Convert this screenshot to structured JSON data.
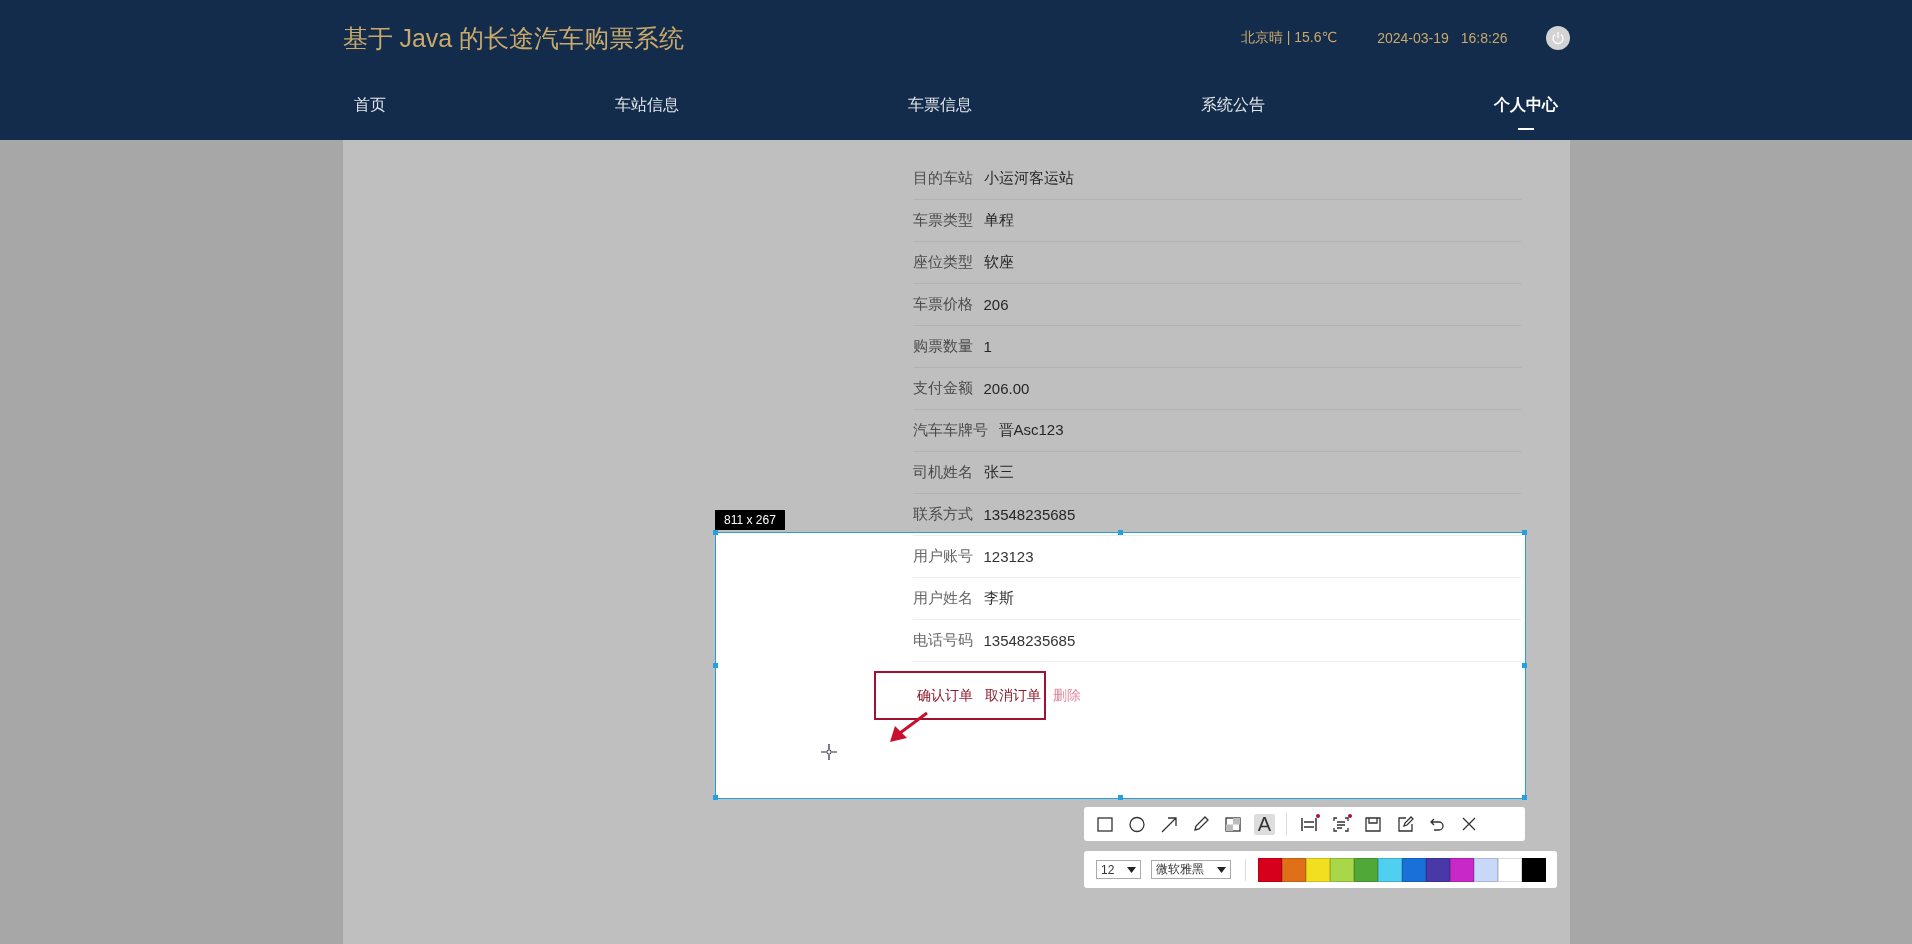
{
  "header": {
    "title": "基于 Java 的长途汽车购票系统",
    "weather": "北京晴 | 15.6℃",
    "date": "2024-03-19",
    "time": "16:8:26"
  },
  "nav": [
    {
      "label": "首页",
      "selected": false
    },
    {
      "label": "车站信息",
      "selected": false
    },
    {
      "label": "车票信息",
      "selected": false
    },
    {
      "label": "系统公告",
      "selected": false
    },
    {
      "label": "个人中心",
      "selected": true
    }
  ],
  "details": [
    {
      "label": "目的车站",
      "value": "小运河客运站"
    },
    {
      "label": "车票类型",
      "value": "单程"
    },
    {
      "label": "座位类型",
      "value": "软座"
    },
    {
      "label": "车票价格",
      "value": "206"
    },
    {
      "label": "购票数量",
      "value": "1"
    },
    {
      "label": "支付金额",
      "value": "206.00"
    },
    {
      "label": "汽车车牌号",
      "value": "晋Asc123"
    },
    {
      "label": "司机姓名",
      "value": "张三"
    },
    {
      "label": "联系方式",
      "value": "13548235685"
    },
    {
      "label": "用户账号",
      "value": "123123"
    },
    {
      "label": "用户姓名",
      "value": "李斯"
    },
    {
      "label": "电话号码",
      "value": "13548235685"
    }
  ],
  "actions": [
    {
      "label": "确认订单",
      "kind": "primary"
    },
    {
      "label": "取消订单",
      "kind": "primary"
    },
    {
      "label": "删除",
      "kind": "danger"
    }
  ],
  "snip": {
    "size_label": "811 x 267",
    "tools": [
      {
        "kind": "rect",
        "selected": false,
        "dot": false
      },
      {
        "kind": "ellipse",
        "selected": false,
        "dot": false
      },
      {
        "kind": "arrow",
        "selected": false,
        "dot": false
      },
      {
        "kind": "pencil",
        "selected": false,
        "dot": false
      },
      {
        "kind": "mosaic",
        "selected": false,
        "dot": false
      },
      {
        "kind": "text",
        "glyph": "A",
        "selected": true,
        "dot": false
      },
      {
        "kind": "separator"
      },
      {
        "kind": "pin",
        "selected": false,
        "dot": true
      },
      {
        "kind": "ocr",
        "selected": false,
        "dot": true
      },
      {
        "kind": "save",
        "selected": false,
        "dot": false
      },
      {
        "kind": "edit",
        "selected": false,
        "dot": false
      },
      {
        "kind": "undo",
        "selected": false,
        "dot": false
      },
      {
        "kind": "close",
        "selected": false,
        "dot": false
      }
    ],
    "font_size": "12",
    "font_name": "微软雅黑",
    "colors": [
      {
        "color": "#d7001c"
      },
      {
        "color": "#e07018"
      },
      {
        "color": "#f2e020"
      },
      {
        "color": "#a8d848"
      },
      {
        "color": "#50a838"
      },
      {
        "color": "#50d0f0"
      },
      {
        "color": "#1870d8"
      },
      {
        "color": "#4838a8"
      },
      {
        "color": "#c828c8"
      },
      {
        "color": "#c8d8f8"
      },
      {
        "color": "#ffffff"
      },
      {
        "color": "#000000"
      }
    ]
  }
}
